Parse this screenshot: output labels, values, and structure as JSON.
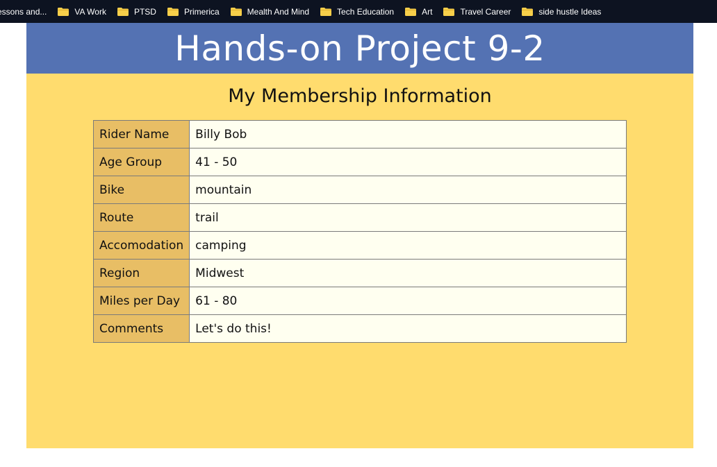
{
  "bookmarks": [
    {
      "label": "essons and...",
      "icon": "folder-icon"
    },
    {
      "label": "VA Work",
      "icon": "folder-icon"
    },
    {
      "label": "PTSD",
      "icon": "folder-icon"
    },
    {
      "label": "Primerica",
      "icon": "folder-icon"
    },
    {
      "label": "Mealth And Mind",
      "icon": "folder-icon"
    },
    {
      "label": "Tech Education",
      "icon": "folder-icon"
    },
    {
      "label": "Art",
      "icon": "folder-icon"
    },
    {
      "label": "Travel Career",
      "icon": "folder-icon"
    },
    {
      "label": "side hustle Ideas",
      "icon": "folder-icon"
    }
  ],
  "page": {
    "title": "Hands-on Project 9-2",
    "subtitle": "My Membership Information",
    "rows": [
      {
        "label": "Rider Name",
        "value": "Billy Bob"
      },
      {
        "label": "Age Group",
        "value": "41 - 50"
      },
      {
        "label": "Bike",
        "value": "mountain"
      },
      {
        "label": "Route",
        "value": "trail"
      },
      {
        "label": "Accomodation",
        "value": "camping"
      },
      {
        "label": "Region",
        "value": "Midwest"
      },
      {
        "label": "Miles per Day",
        "value": "61 - 80"
      },
      {
        "label": "Comments",
        "value": "Let's do this!"
      }
    ]
  },
  "colors": {
    "bookmark_bar": "#0d1321",
    "header": "#5472b3",
    "page_bg": "#ffdc6e",
    "label_cell": "#e8be65",
    "value_cell": "#fffff0",
    "folder": "#f7cf4a"
  }
}
